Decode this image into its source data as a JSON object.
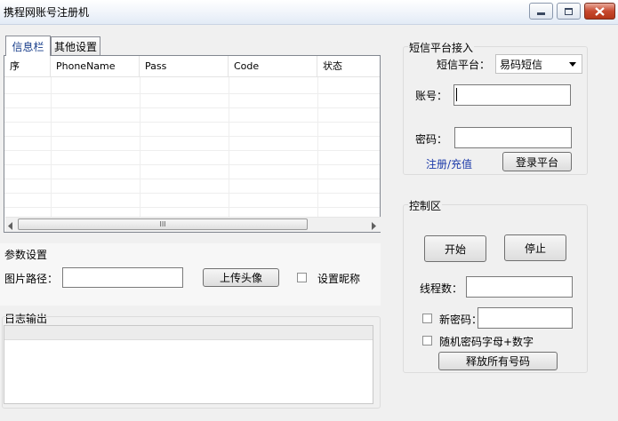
{
  "window": {
    "title": "携程网账号注册机"
  },
  "tabs": [
    {
      "label": "信息栏"
    },
    {
      "label": "其他设置"
    }
  ],
  "table": {
    "columns": [
      "序",
      "PhoneName",
      "Pass",
      "Code",
      "状态"
    ]
  },
  "params": {
    "title": "参数设置",
    "image_path_label": "图片路径：",
    "image_path_value": "",
    "upload_label": "上传头像",
    "nickname_label": "设置昵称"
  },
  "log": {
    "title": "日志输出"
  },
  "sms": {
    "title": "短信平台接入",
    "platform_label": "短信平台：",
    "platform_value": "易码短信",
    "account_label": "账号：",
    "account_value": "",
    "password_label": "密码：",
    "password_value": "",
    "register_link": "注册/充值",
    "login_label": "登录平台"
  },
  "control": {
    "title": "控制区",
    "start_label": "开始",
    "stop_label": "停止",
    "threads_label": "线程数：",
    "threads_value": "",
    "new_password_label": "新密码：",
    "new_password_value": "",
    "random_password_label": "随机密码字母+数字",
    "release_label": "释放所有号码"
  },
  "scroll": {
    "thumb_glyph": "III"
  }
}
